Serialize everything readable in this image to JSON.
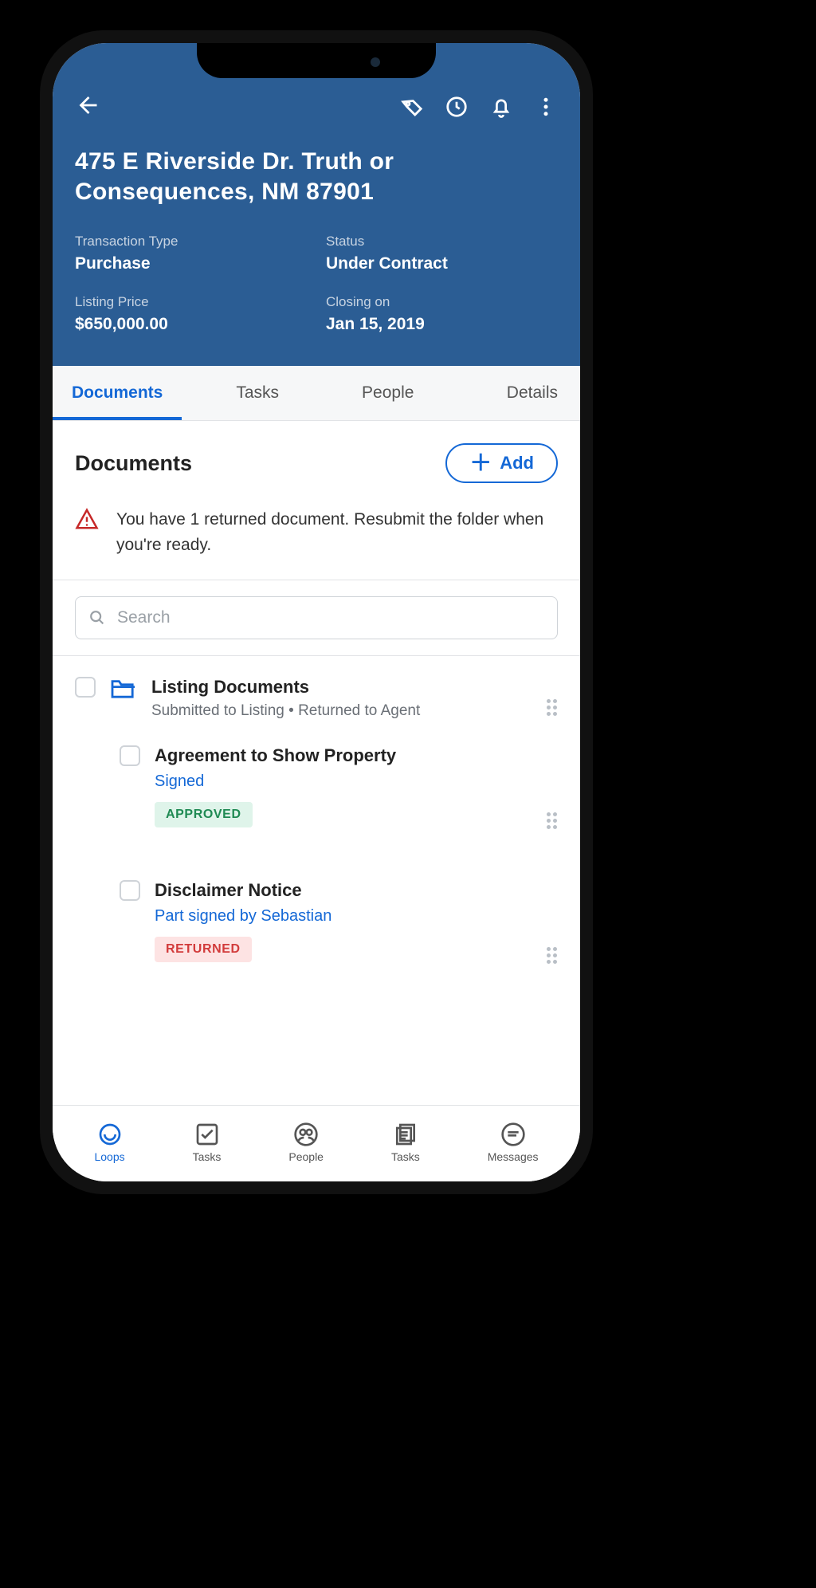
{
  "header": {
    "title": "475 E Riverside Dr. Truth or Consequences, NM 87901",
    "fields": {
      "transaction_type_label": "Transaction Type",
      "transaction_type_value": "Purchase",
      "status_label": "Status",
      "status_value": "Under Contract",
      "listing_price_label": "Listing Price",
      "listing_price_value": "$650,000.00",
      "closing_label": "Closing on",
      "closing_value": "Jan 15, 2019"
    }
  },
  "tabs": {
    "documents": "Documents",
    "tasks": "Tasks",
    "people": "People",
    "details": "Details"
  },
  "section": {
    "title": "Documents",
    "add_label": "Add"
  },
  "alert": {
    "text": "You have 1 returned document. Resubmit the folder when you're ready."
  },
  "search": {
    "placeholder": "Search"
  },
  "folder": {
    "title": "Listing Documents",
    "subtitle": "Submitted to Listing • Returned to Agent"
  },
  "docs": [
    {
      "title": "Agreement to Show Property",
      "status": "Signed",
      "badge": "APPROVED",
      "badge_kind": "approved"
    },
    {
      "title": "Disclaimer Notice",
      "status": "Part signed by Sebastian",
      "badge": "RETURNED",
      "badge_kind": "returned"
    }
  ],
  "bottom_nav": {
    "loops": "Loops",
    "tasks": "Tasks",
    "people": "People",
    "tasks2": "Tasks",
    "messages": "Messages"
  }
}
